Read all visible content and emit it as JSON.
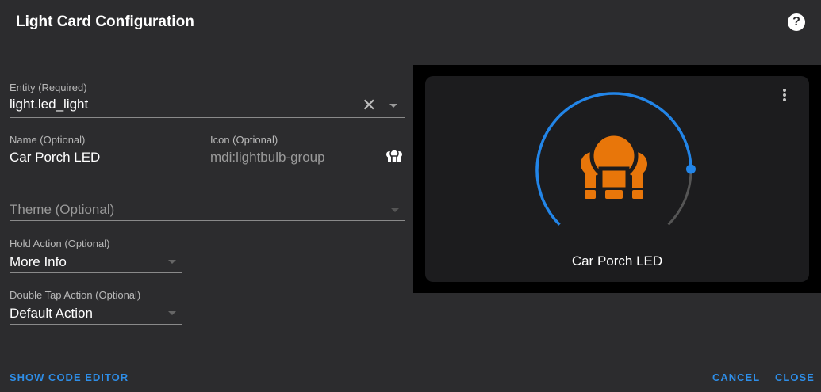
{
  "dialog": {
    "title": "Light Card Configuration",
    "help_icon": "help-circle-icon"
  },
  "form": {
    "entity": {
      "label": "Entity (Required)",
      "value": "light.led_light"
    },
    "name": {
      "label": "Name (Optional)",
      "value": "Car Porch LED"
    },
    "icon": {
      "label": "Icon (Optional)",
      "value": "mdi:lightbulb-group"
    },
    "theme": {
      "placeholder": "Theme (Optional)"
    },
    "hold_action": {
      "label": "Hold Action (Optional)",
      "value": "More Info"
    },
    "double_tap_action": {
      "label": "Double Tap Action (Optional)",
      "value": "Default Action"
    }
  },
  "preview": {
    "name": "Car Porch LED",
    "brightness_fraction": 0.83,
    "accent": "#2285e8",
    "icon_color": "#e8760a",
    "track_color": "#555555"
  },
  "footer": {
    "show_code_editor": "SHOW CODE EDITOR",
    "cancel": "CANCEL",
    "close": "CLOSE"
  }
}
